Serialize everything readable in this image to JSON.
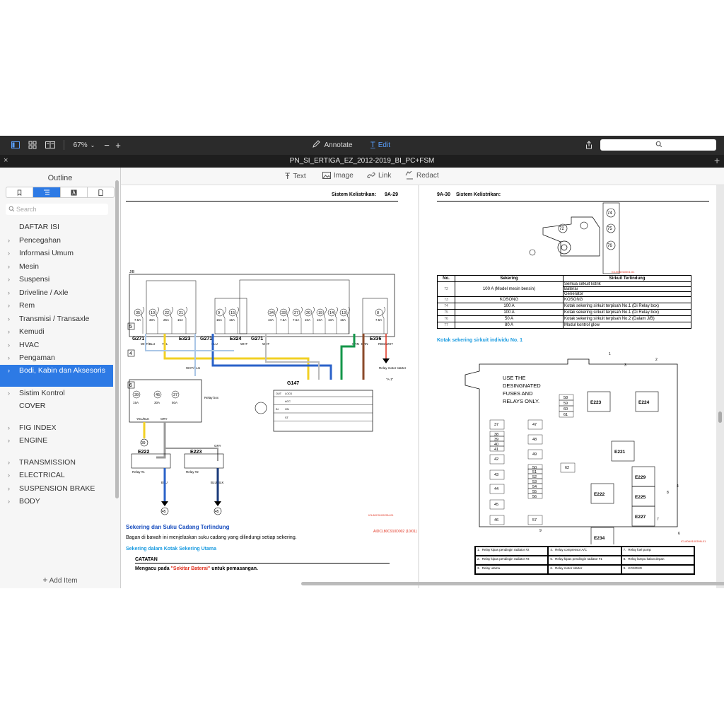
{
  "toolbar": {
    "zoom": "67%",
    "annotate_label": "Annotate",
    "edit_label": "Edit"
  },
  "tab": {
    "title": "PN_SI_ERTIGA_EZ_2012-2019_BI_PC+FSM"
  },
  "sidebar": {
    "title": "Outline",
    "search_placeholder": "Search",
    "add_item_label": "Add Item",
    "items": [
      {
        "label": "DAFTAR ISI",
        "chevron": false
      },
      {
        "label": "Pencegahan",
        "chevron": true
      },
      {
        "label": "Informasi Umum",
        "chevron": true
      },
      {
        "label": "Mesin",
        "chevron": true
      },
      {
        "label": "Suspensi",
        "chevron": true
      },
      {
        "label": "Driveline / Axle",
        "chevron": true
      },
      {
        "label": "Rem",
        "chevron": true
      },
      {
        "label": "Transmisi / Transaxle",
        "chevron": true
      },
      {
        "label": "Kemudi",
        "chevron": true
      },
      {
        "label": "HVAC",
        "chevron": true
      },
      {
        "label": "Pengaman",
        "chevron": true
      },
      {
        "label": "Bodi, Kabin dan Aksesoris",
        "chevron": true,
        "selected": true
      },
      {
        "label": "Sistim Kontrol",
        "chevron": true
      },
      {
        "label": "COVER",
        "chevron": false
      },
      {
        "label": "FIG INDEX",
        "chevron": true,
        "gap_before": true
      },
      {
        "label": "ENGINE",
        "chevron": true
      },
      {
        "label": "TRANSMISSION",
        "chevron": true,
        "gap_before": true
      },
      {
        "label": "ELECTRICAL",
        "chevron": true
      },
      {
        "label": "SUSPENSION BRAKE",
        "chevron": true
      },
      {
        "label": "BODY",
        "chevron": true
      }
    ]
  },
  "edit_toolbar": {
    "text_label": "Text",
    "image_label": "Image",
    "link_label": "Link",
    "redact_label": "Redact"
  },
  "left_page": {
    "header": "Sistem Kelistrikan:",
    "page_no": "9A-29",
    "jb_label": "J/B",
    "fig_code": "ICL80C910929N-01",
    "doc_code": "AIDCL80C910D002 (10/01)",
    "section_title": "Sekering dan Suku Cadang Terlindung",
    "section_body": "Bagan di bawah ini menjelaskan suku cadang yang dilindungi setiap sekering.",
    "sub_title": "Sekering dalam Kotak Sekering Utama",
    "catatan_label": "CATATAN",
    "catatan_pre": "Mengacu pada ",
    "catatan_link": "\"Sekitar Baterai\"",
    "catatan_post": " untuk pemasangan.",
    "fuses": [
      {
        "no": "35",
        "amp": "7.5A"
      },
      {
        "no": "10",
        "amp": "30A"
      },
      {
        "no": "22",
        "amp": "25A"
      },
      {
        "no": "21",
        "amp": "15A"
      },
      {
        "no": "9",
        "amp": "15A"
      },
      {
        "no": "15",
        "amp": "15A"
      },
      {
        "no": "34",
        "amp": "10A"
      },
      {
        "no": "33",
        "amp": "7.5A"
      },
      {
        "no": "27",
        "amp": "7.5A"
      },
      {
        "no": "20",
        "amp": "10A"
      },
      {
        "no": "19",
        "amp": "10A"
      },
      {
        "no": "14",
        "amp": "10A"
      },
      {
        "no": "13",
        "amp": "15A"
      },
      {
        "no": "8",
        "amp": "7.5A"
      }
    ],
    "connectors": [
      "G271",
      "E323",
      "G271",
      "E324",
      "G271",
      "E336",
      "G147",
      "E222",
      "E223"
    ],
    "wire_labels": [
      "WHT/BLU",
      "YEL",
      "BLU",
      "WHT",
      "WHT",
      "GRN",
      "BRN",
      "RED/WHT",
      "WHT/BLU",
      "YEL/BLK",
      "GRY",
      "GRY",
      "BLU",
      "BLU/BLK"
    ],
    "relay_box_label": "Relay box",
    "relay_starter": "Relay motor starter",
    "relay_starter_ref": "\"A-1\"",
    "relay1": "Relay #1",
    "relay2": "Relay #2",
    "box_fuses": [
      {
        "no": "39",
        "amp": "15A"
      },
      {
        "no": "45",
        "amp": "30A"
      },
      {
        "no": "37",
        "amp": "50A"
      }
    ],
    "ignition": [
      "OUT",
      "LOCK",
      "ACC",
      "IN",
      "ON",
      "ST"
    ],
    "grounds": [
      "39",
      "45",
      "45"
    ],
    "markers": [
      "5",
      "4",
      "6"
    ]
  },
  "right_page": {
    "page_no": "9A-30",
    "header": "Sistem Kelistrikan:",
    "fig_code1": "ICL80A910001-01",
    "battery_labels": [
      "72",
      "74",
      "75",
      "76"
    ],
    "table_headers": [
      "No.",
      "Sekering",
      "Sirkuit Terlindung"
    ],
    "table_rows": [
      {
        "no": "72",
        "fuse": "100 A (Model mesin bensin)",
        "circuits": [
          "Semua sirkuit listrik",
          "Baterai",
          "Generator"
        ]
      },
      {
        "no": "73",
        "fuse": "KOSONG",
        "circuits": [
          "KOSONG"
        ]
      },
      {
        "no": "74",
        "fuse": "100 A",
        "circuits": [
          "Kotak sekering sirkuit terpisah No.1 (Di Relay box)"
        ]
      },
      {
        "no": "75",
        "fuse": "100 A",
        "circuits": [
          "Kotak sekering sirkuit terpisah No.1 (Di Relay box)"
        ]
      },
      {
        "no": "76",
        "fuse": "50 A",
        "circuits": [
          "Kotak sekering sirkuit terpisah No.2 (Dalam J/B)"
        ]
      },
      {
        "no": "77",
        "fuse": "80 A",
        "circuits": [
          "Modul kontrol glow"
        ]
      }
    ],
    "sub_title": "Kotak sekering sirkuit individu No. 1",
    "box_note": [
      "USE THE",
      "DESINGNATED",
      "FUSES AND",
      "RELAYS ONLY."
    ],
    "relays": [
      "E223",
      "E224",
      "E221",
      "E229",
      "E222",
      "E225",
      "E227",
      "E234"
    ],
    "fuse_nums_top": [
      "58",
      "59",
      "60",
      "61"
    ],
    "fuse_nums_left": [
      "37",
      "38",
      "39",
      "40",
      "41",
      "42",
      "43",
      "44",
      "45",
      "46"
    ],
    "fuse_nums_mid": [
      "47",
      "48",
      "49",
      "50",
      "51",
      "52",
      "53",
      "54",
      "55",
      "56",
      "57",
      "62"
    ],
    "callouts": [
      "1",
      "2",
      "3",
      "4",
      "5",
      "6",
      "7",
      "8",
      "9"
    ],
    "fig_code2": "ICL80A910039N-01",
    "legend": [
      {
        "no": "1.",
        "text": "Relay kipas pendingin radiator #2"
      },
      {
        "no": "4.",
        "text": "Relay compressor A/C"
      },
      {
        "no": "7.",
        "text": "Relay fuel pump"
      },
      {
        "no": "2.",
        "text": "Relay kipas pendingin radiator #3"
      },
      {
        "no": "5.",
        "text": "Relay kipas pendingin radiator #1"
      },
      {
        "no": "8.",
        "text": "Relay lampu kabut depan"
      },
      {
        "no": "3.",
        "text": "Relay utama"
      },
      {
        "no": "6.",
        "text": "Relay motor starter"
      },
      {
        "no": "9.",
        "text": "KOSONG"
      }
    ]
  },
  "colors": {
    "accent": "#2d7ae5",
    "toolbar_bg": "#2b2b2b",
    "link_red": "#e0301e",
    "section_blue": "#1a4fbf"
  }
}
